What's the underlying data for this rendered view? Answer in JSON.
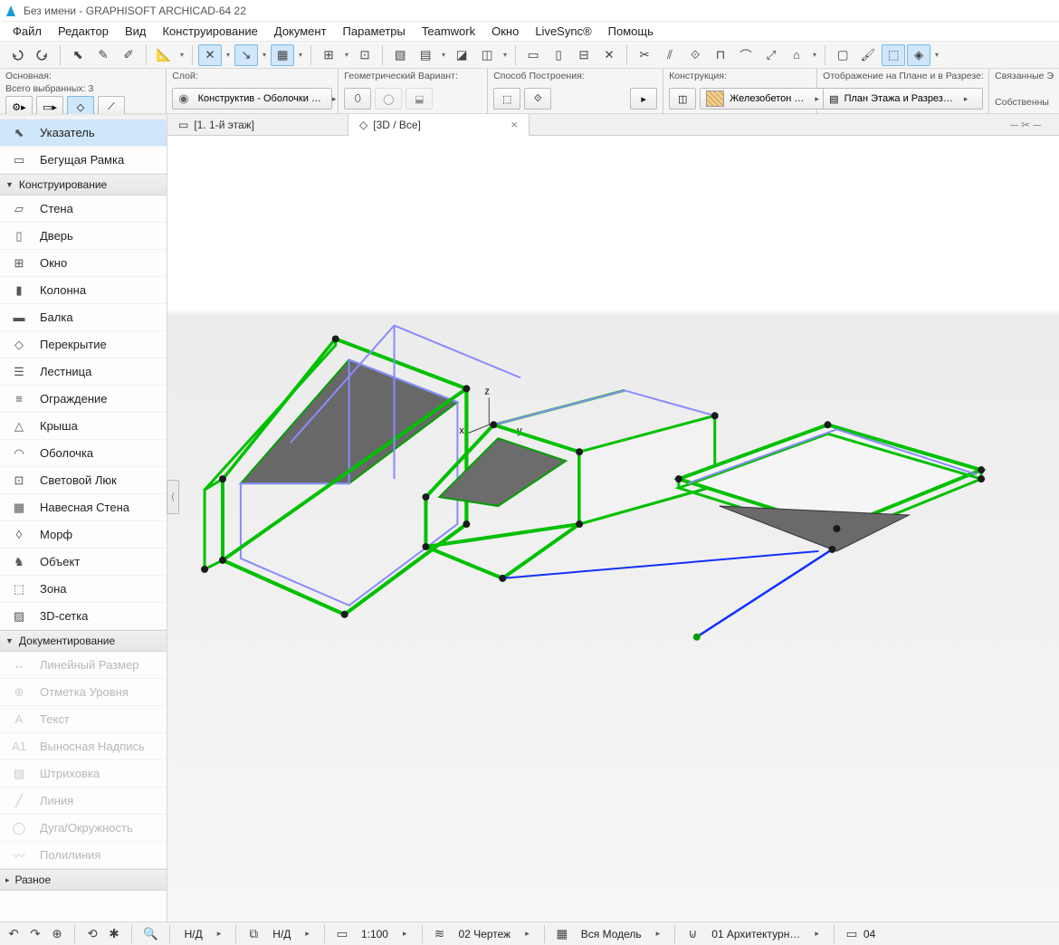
{
  "title": "Без имени - GRAPHISOFT ARCHICAD-64 22",
  "menu": [
    "Файл",
    "Редактор",
    "Вид",
    "Конструирование",
    "Документ",
    "Параметры",
    "Teamwork",
    "Окно",
    "LiveSync®",
    "Помощь"
  ],
  "info": {
    "cell_main_label": "Основная:",
    "cell_selected_label": "Всего выбранных: 3",
    "cell_layer_label": "Слой:",
    "cell_layer_value": "Конструктив - Оболочки …",
    "cell_geometry_label": "Геометрический Вариант:",
    "cell_construction_label": "Способ Построения:",
    "cell_structure_label": "Конструкция:",
    "cell_structure_value": "Железобетон …",
    "cell_display_label": "Отображение на Плане и в Разрезе:",
    "cell_display_value": "План Этажа и Разрез…",
    "cell_linked_label": "Связанные Э",
    "cell_own_label": "Собственны"
  },
  "tools_pointer": "Указатель",
  "tools_marquee": "Бегущая Рамка",
  "group_design": "Конструирование",
  "tools_design": [
    "Стена",
    "Дверь",
    "Окно",
    "Колонна",
    "Балка",
    "Перекрытие",
    "Лестница",
    "Ограждение",
    "Крыша",
    "Оболочка",
    "Световой Люк",
    "Навесная Стена",
    "Морф",
    "Объект",
    "Зона",
    "3D-сетка"
  ],
  "group_document": "Документирование",
  "tools_document": [
    "Линейный Размер",
    "Отметка Уровня",
    "Текст",
    "Выносная Надпись",
    "Штриховка",
    "Линия",
    "Дуга/Окружность",
    "Полилиния"
  ],
  "group_misc": "Разное",
  "tab1": "[1. 1-й этаж]",
  "tab2": "[3D / Все]",
  "statusbar": {
    "na": "Н/Д",
    "scale": "1:100",
    "drafting": "02 Чертеж",
    "model": "Вся Модель",
    "arch": "01 Архитектурн…",
    "last": "04"
  },
  "axes": {
    "x": "x",
    "y": "y",
    "z": "z"
  }
}
